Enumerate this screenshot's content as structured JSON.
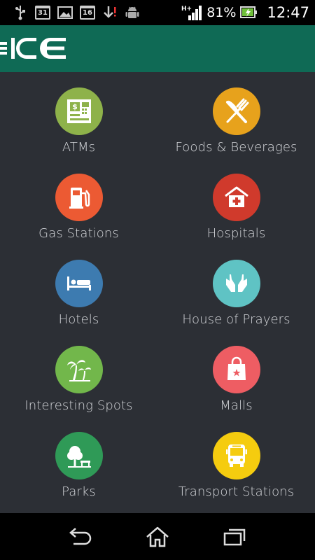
{
  "status_bar": {
    "calendar_day": "31",
    "date_badge": "16",
    "network_type": "H+",
    "battery_percent": "81%",
    "time": "12:47",
    "icons": [
      "usb-icon",
      "calendar-icon",
      "gallery-icon",
      "date-icon",
      "download-icon",
      "android-icon",
      "signal-icon",
      "battery-icon"
    ]
  },
  "header": {
    "app_name": "ICE",
    "background_color": "#0f6a55"
  },
  "categories": [
    {
      "label": "ATMs",
      "color": "#8eb24a",
      "icon": "atm-icon"
    },
    {
      "label": "Foods & Beverages",
      "color": "#e7a21c",
      "icon": "fork-knife-icon"
    },
    {
      "label": "Gas Stations",
      "color": "#ec5a33",
      "icon": "gas-pump-icon"
    },
    {
      "label": "Hospitals",
      "color": "#d03a2c",
      "icon": "hospital-icon"
    },
    {
      "label": "Hotels",
      "color": "#3d7bb0",
      "icon": "bed-icon"
    },
    {
      "label": "House of Prayers",
      "color": "#5fc3c4",
      "icon": "praying-hands-icon"
    },
    {
      "label": "Interesting Spots",
      "color": "#72b74b",
      "icon": "palm-tree-icon"
    },
    {
      "label": "Malls",
      "color": "#ee5d63",
      "icon": "shopping-bag-icon"
    },
    {
      "label": "Parks",
      "color": "#2f9a57",
      "icon": "park-icon"
    },
    {
      "label": "Transport Stations",
      "color": "#f5cc0f",
      "icon": "bus-icon"
    }
  ],
  "nav_bar": {
    "buttons": [
      "back-icon",
      "home-icon",
      "recent-apps-icon"
    ]
  }
}
